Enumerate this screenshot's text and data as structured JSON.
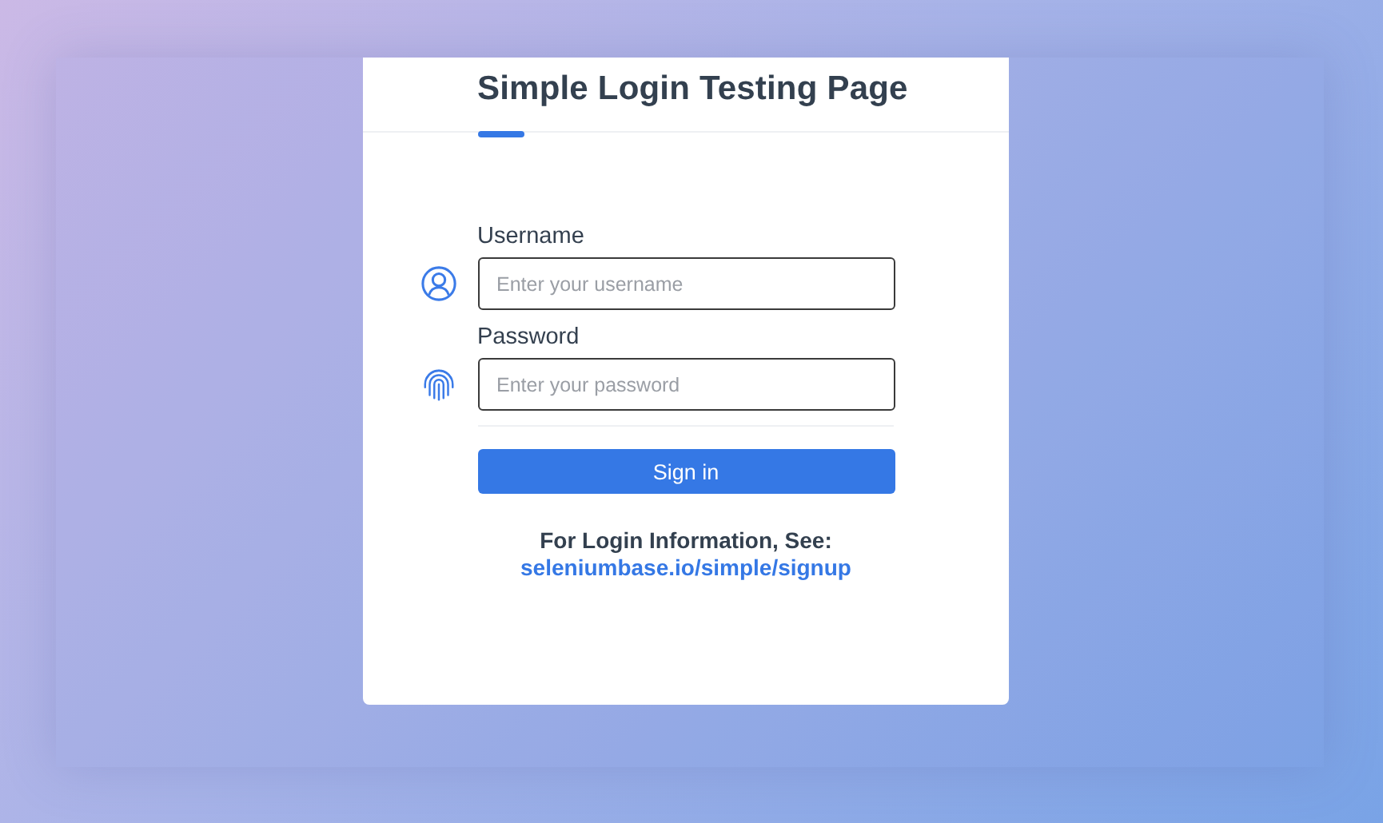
{
  "title": "Simple Login Testing Page",
  "fields": [
    {
      "label": "Username",
      "placeholder": "Enter your username",
      "kind": "user"
    },
    {
      "label": "Password",
      "placeholder": "Enter your password",
      "kind": "fingerprint"
    }
  ],
  "button": "Sign in",
  "info": {
    "text": "For Login Information, See:",
    "link": "seleniumbase.io/simple/signup"
  }
}
